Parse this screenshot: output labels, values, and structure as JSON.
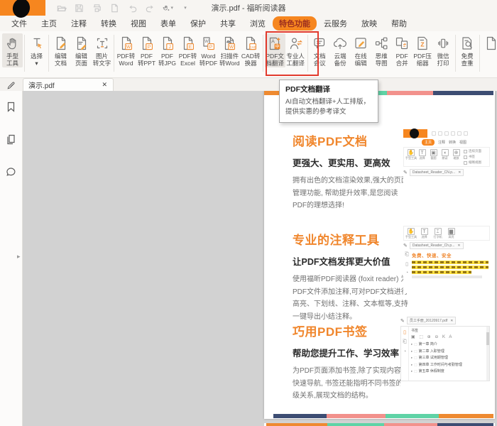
{
  "window": {
    "title": "演示.pdf - 福昕阅读器"
  },
  "titlebar": {
    "quick_icons": [
      "open-folder",
      "save",
      "print",
      "export-page",
      "undo",
      "redo",
      "hand-select",
      "customize-caret"
    ]
  },
  "menu": {
    "items": [
      {
        "label": "文件",
        "active": false
      },
      {
        "label": "主页",
        "active": false
      },
      {
        "label": "注释",
        "active": false
      },
      {
        "label": "转换",
        "active": false
      },
      {
        "label": "视图",
        "active": false
      },
      {
        "label": "表单",
        "active": false
      },
      {
        "label": "保护",
        "active": false
      },
      {
        "label": "共享",
        "active": false
      },
      {
        "label": "浏览",
        "active": false
      },
      {
        "label": "特色功能",
        "active": true
      },
      {
        "label": "云服务",
        "active": false
      },
      {
        "label": "放映",
        "active": false
      },
      {
        "label": "帮助",
        "active": false
      }
    ]
  },
  "toolbar": {
    "groups": [
      {
        "items": [
          {
            "name": "hand-tool",
            "icon": "hand",
            "line1": "手型",
            "line2": "工具",
            "selected": true
          }
        ]
      },
      {
        "items": [
          {
            "name": "select-tool",
            "icon": "select",
            "line1": "选择",
            "line2": "▾",
            "selected": false
          }
        ]
      },
      {
        "items": [
          {
            "name": "edit-document",
            "icon": "edit-doc",
            "line1": "编辑",
            "line2": "文档",
            "selected": false
          },
          {
            "name": "edit-page",
            "icon": "edit-page",
            "line1": "编辑",
            "line2": "页面",
            "selected": false
          },
          {
            "name": "image-to-text",
            "icon": "img2txt",
            "line1": "图片",
            "line2": "转文字",
            "selected": false
          }
        ]
      },
      {
        "items": [
          {
            "name": "pdf-to-word",
            "icon": "doc-w",
            "line1": "PDF转",
            "line2": "Word",
            "selected": false
          },
          {
            "name": "pdf-to-ppt",
            "icon": "doc-p",
            "line1": "PDF",
            "line2": "转PPT",
            "selected": false
          },
          {
            "name": "pdf-to-jpg",
            "icon": "doc-j",
            "line1": "PDF",
            "line2": "转JPG",
            "selected": false
          },
          {
            "name": "pdf-to-excel",
            "icon": "doc-e",
            "line1": "PDF转",
            "line2": "Excel",
            "selected": false
          },
          {
            "name": "word-to-pdf",
            "icon": "w2pdf",
            "line1": "Word",
            "line2": "转PDF",
            "selected": false
          },
          {
            "name": "scan-to-word",
            "icon": "scanw",
            "line1": "扫描件",
            "line2": "转Word",
            "selected": false
          },
          {
            "name": "cad-converter",
            "icon": "cad",
            "line1": "CAD转",
            "line2": "换器",
            "selected": false
          }
        ]
      },
      {
        "items": [
          {
            "name": "pdf-doc-translate",
            "icon": "translate",
            "line1": "PDF文",
            "line2": "档翻译",
            "selected": true
          },
          {
            "name": "pro-human-translate",
            "icon": "humantr",
            "line1": "专业人",
            "line2": "工翻译",
            "selected": false
          }
        ]
      },
      {
        "items": [
          {
            "name": "doc-meeting",
            "icon": "meeting",
            "line1": "文档",
            "line2": "会议",
            "selected": false
          },
          {
            "name": "cloud-backup",
            "icon": "cloud",
            "line1": "云端",
            "line2": "备份",
            "selected": false
          },
          {
            "name": "online-edit",
            "icon": "oledit",
            "line1": "在线",
            "line2": "编辑",
            "selected": false
          },
          {
            "name": "mind-map",
            "icon": "mindmap",
            "line1": "思维",
            "line2": "导图",
            "selected": false
          },
          {
            "name": "pdf-merge",
            "icon": "merge",
            "line1": "PDF",
            "line2": "合并",
            "selected": false
          },
          {
            "name": "pdf-compress",
            "icon": "compress",
            "line1": "PDF压",
            "line2": "缩器",
            "selected": false
          },
          {
            "name": "wechat-print",
            "icon": "wxprint",
            "line1": "微信",
            "line2": "打印",
            "selected": false
          }
        ]
      },
      {
        "items": [
          {
            "name": "free-check",
            "icon": "check",
            "line1": "免费",
            "line2": "查重",
            "selected": false
          }
        ]
      },
      {
        "items": [
          {
            "name": "clipped-item",
            "icon": "doc",
            "line1": "",
            "line2": "",
            "selected": false
          }
        ]
      }
    ]
  },
  "annotation": {
    "tooltip_title": "PDF文档翻译",
    "tooltip_body": "AI自动文档翻译+人工排版，提供实惠的参考译文"
  },
  "doc_tab": {
    "label": "演示.pdf",
    "close": "✕"
  },
  "page": {
    "sections": [
      {
        "heading": "阅读PDF文档",
        "subheading": "更强大、更实用、更高效",
        "body": "拥有出色的文档渲染效果,强大的页面管理功能, 帮助提升效率,是您阅读PDF的理想选择!"
      },
      {
        "heading": "专业的注释工具",
        "subheading": "让PDF文档发挥更大价值",
        "body": "使用福昕PDF阅读器 (foxit reader) 为PDF文件添加注释,可对PDF文档进行高亮、下划线、注释、文本框等,支持一键导出小结注释。"
      },
      {
        "heading": "巧用PDF书签",
        "subheading": "帮助您提升工作、学习效率",
        "body": "为PDF页面添加书签,除了实现内容的快速导航, 书签还能指明不同书签的层级关系,展现文档的结构。"
      }
    ]
  },
  "thumbs": {
    "t1": {
      "tabs": [
        "主页",
        "注释",
        "转换",
        "视图"
      ],
      "tools": [
        "手型工具",
        "选择",
        "截图",
        "朗读",
        "缩放"
      ],
      "views": [
        "连续页面",
        "书签",
        "缩略视图"
      ],
      "doc_tab": "Datasheet_Reader_CN.p...",
      "close": "✕"
    },
    "t2": {
      "doc_tab": "Datasheet_Reader_Ch.p...",
      "slogan": "免费、快速、安全",
      "tools": [
        "手型工具",
        "选择",
        "打字机",
        "高亮"
      ],
      "close": "✕"
    },
    "t3": {
      "doc_tab": "员工手册_20120917.pdf",
      "panel_title": "书签",
      "bookmarks": [
        "第一章 简介",
        "第二章 入职管理",
        "第三章 试用期管理",
        "第四章 工作时间与考勤管理",
        "第五章 休假制度"
      ],
      "close": "✕"
    }
  },
  "colors": {
    "brand_orange": "#f6861f",
    "callout_red": "#e23b2e",
    "stripe_navy": "#3d4d73",
    "stripe_pink": "#f2918c",
    "stripe_teal": "#5fd3a6",
    "stripe_orange": "#ee8a31"
  }
}
